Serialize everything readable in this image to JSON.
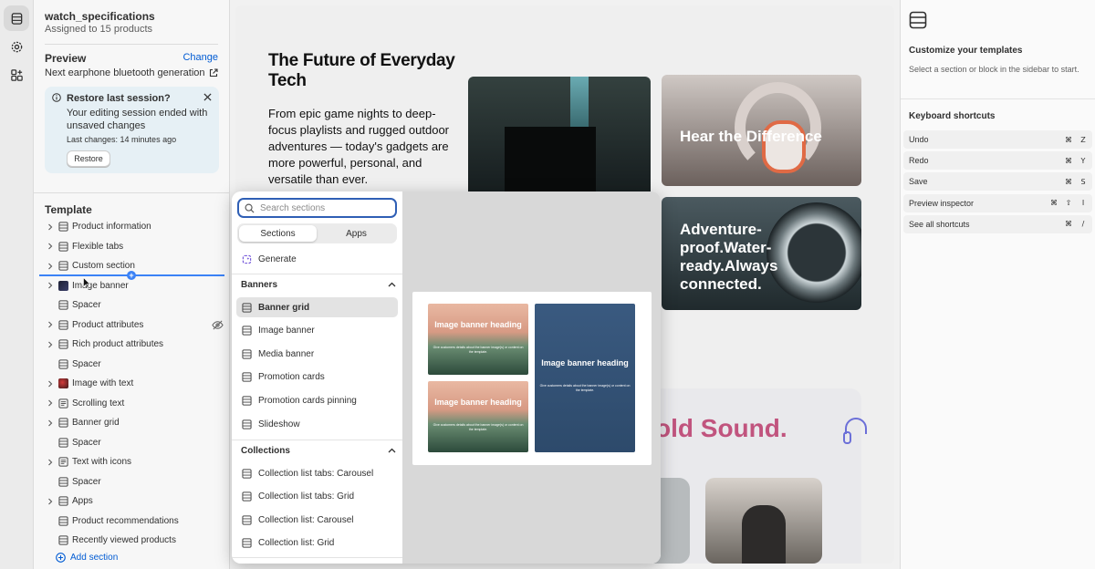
{
  "sidebar": {
    "template_name": "watch_specifications",
    "assigned": "Assigned to 15 products",
    "preview_label": "Preview",
    "preview_change": "Change",
    "preview_product": "Next earphone bluetooth generation",
    "restore": {
      "title": "Restore last session?",
      "message": "Your editing session ended with unsaved changes",
      "last_changes": "Last changes: 14 minutes ago",
      "button": "Restore"
    },
    "template_label": "Template",
    "items": [
      {
        "label": "Product information",
        "icon": "section-icon",
        "chevron": true
      },
      {
        "label": "Flexible tabs",
        "icon": "section-icon",
        "chevron": true
      },
      {
        "label": "Custom section",
        "icon": "section-icon",
        "chevron": true
      },
      {
        "label": "Image banner",
        "icon": "thumb-dark",
        "chevron": true
      },
      {
        "label": "Spacer",
        "icon": "section-icon",
        "chevron": false
      },
      {
        "label": "Product attributes",
        "icon": "section-icon",
        "chevron": true,
        "hidden": true
      },
      {
        "label": "Rich product attributes",
        "icon": "section-icon",
        "chevron": true
      },
      {
        "label": "Spacer",
        "icon": "section-icon",
        "chevron": false
      },
      {
        "label": "Image with text",
        "icon": "thumb-red",
        "chevron": true
      },
      {
        "label": "Scrolling text",
        "icon": "text-icon",
        "chevron": true
      },
      {
        "label": "Banner grid",
        "icon": "section-icon",
        "chevron": true
      },
      {
        "label": "Spacer",
        "icon": "section-icon",
        "chevron": false
      },
      {
        "label": "Text with icons",
        "icon": "text-icon",
        "chevron": true
      },
      {
        "label": "Spacer",
        "icon": "section-icon",
        "chevron": false
      },
      {
        "label": "Apps",
        "icon": "section-icon",
        "chevron": true
      },
      {
        "label": "Product recommendations",
        "icon": "section-icon",
        "chevron": false
      },
      {
        "label": "Recently viewed products",
        "icon": "section-icon",
        "chevron": false
      }
    ],
    "add_section": "Add section"
  },
  "canvas": {
    "hero_title": "The Future of Everyday Tech",
    "hero_body": "From epic game nights to deep-focus playlists and rugged outdoor adventures — today's gadgets are more powerful, personal, and versatile than ever.",
    "card_headphones": "Hear the Difference",
    "card_watch": "Adventure-proof.Water-ready.Always connected.",
    "bold_sound": "old Sound."
  },
  "popover": {
    "search_placeholder": "Search sections",
    "tab_sections": "Sections",
    "tab_apps": "Apps",
    "generate": "Generate",
    "group_banners": "Banners",
    "banners": [
      "Banner grid",
      "Image banner",
      "Media banner",
      "Promotion cards",
      "Promotion cards pinning",
      "Slideshow"
    ],
    "selected": "Banner grid",
    "group_collections": "Collections",
    "collections": [
      "Collection list tabs: Carousel",
      "Collection list tabs: Grid",
      "Collection list: Carousel",
      "Collection list: Grid"
    ],
    "preview": {
      "heading": "Image banner heading",
      "subtext": "Give customers details about the banner image(s) or content on the template."
    }
  },
  "right_panel": {
    "title": "Customize your templates",
    "subtitle": "Select a section or block in the sidebar to start.",
    "shortcuts_title": "Keyboard shortcuts",
    "shortcuts": [
      {
        "label": "Undo",
        "keys": [
          "⌘",
          "Z"
        ]
      },
      {
        "label": "Redo",
        "keys": [
          "⌘",
          "Y"
        ]
      },
      {
        "label": "Save",
        "keys": [
          "⌘",
          "S"
        ]
      },
      {
        "label": "Preview inspector",
        "keys": [
          "⌘",
          "⇧",
          "I"
        ]
      },
      {
        "label": "See all shortcuts",
        "keys": [
          "⌘",
          "/"
        ]
      }
    ]
  },
  "colors": {
    "accent_blue": "#005bd3",
    "insert_line": "#3b82f6",
    "restore_bg": "#e6f0f5",
    "bold_sound": "#c1547e"
  }
}
